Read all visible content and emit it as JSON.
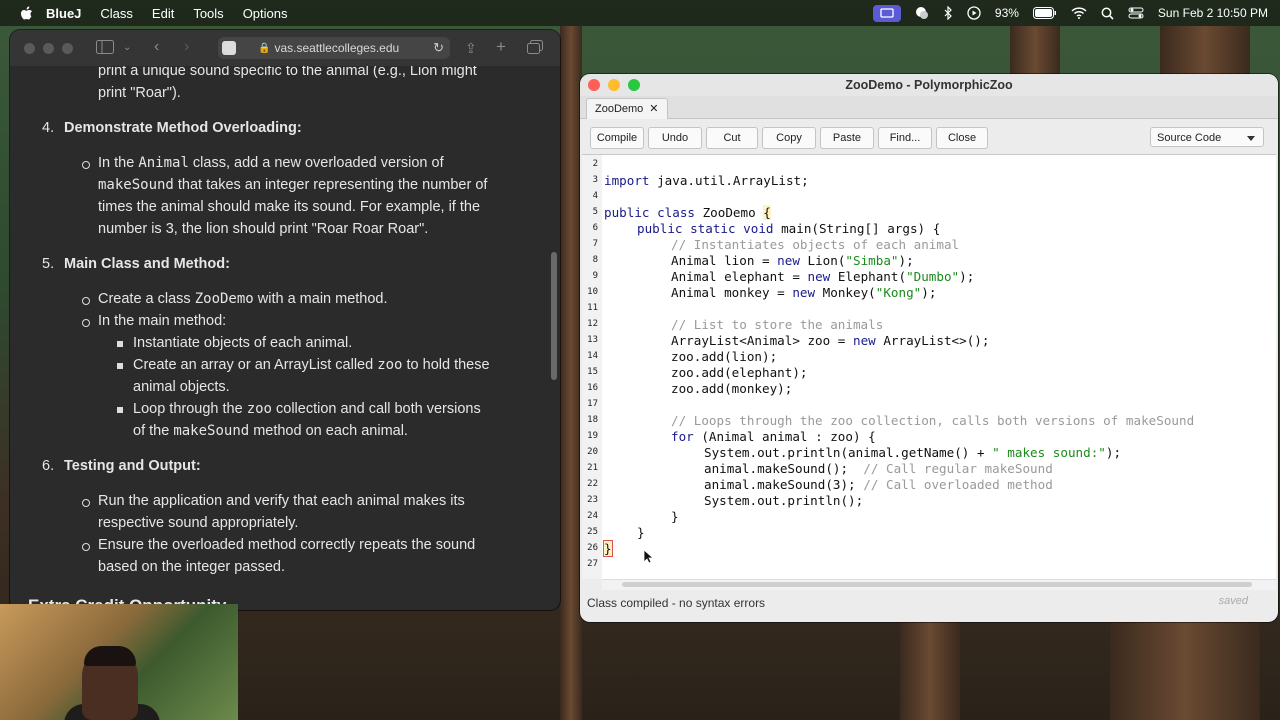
{
  "menubar": {
    "app_name": "BlueJ",
    "items": [
      "Class",
      "Edit",
      "Tools",
      "Options"
    ],
    "battery": "93%",
    "datetime": "Sun Feb 2  10:50 PM"
  },
  "browser": {
    "url": "vas.seattlecolleges.edu",
    "content": {
      "intro_lines": [
        "print a unique sound specific to the animal (e.g., Lion might",
        "print \"Roar\")."
      ],
      "section4": {
        "num": "4.",
        "title": "Demonstrate Method Overloading:",
        "bullet_line1_pre": "In the ",
        "bullet_line1_code": "Animal",
        "bullet_line1_post": " class, add a new overloaded version of",
        "bullet_line2_code": "makeSound",
        "bullet_line2_post": " that takes an integer representing the number of",
        "bullet_line3": "times the animal should make its sound. For example, if the",
        "bullet_line4": "number is 3, the lion should print \"Roar Roar Roar\"."
      },
      "section5": {
        "num": "5.",
        "title": "Main Class and Method:",
        "b1_pre": "Create a class ",
        "b1_code": "ZooDemo",
        "b1_post": " with a main method.",
        "b2": "In the main method:",
        "s1": "Instantiate objects of each animal.",
        "s2_pre": "Create an array or an ArrayList called ",
        "s2_code": "zoo",
        "s2_post": " to hold these",
        "s2_line2": "animal objects.",
        "s3_pre": "Loop through the ",
        "s3_code": "zoo",
        "s3_post": " collection and call both versions",
        "s3_line2_pre": "of the ",
        "s3_line2_code": "makeSound",
        "s3_line2_post": " method on each animal."
      },
      "section6": {
        "num": "6.",
        "title": "Testing and Output:",
        "b1": "Run the application and verify that each animal makes its",
        "b1_line2": "respective sound appropriately.",
        "b2": "Ensure the overloaded method correctly repeats the sound",
        "b2_line2": "based on the integer passed."
      },
      "cut_heading": "Extra Credit Opportunity"
    }
  },
  "bluej": {
    "window_title": "ZooDemo - PolymorphicZoo",
    "tab_label": "ZooDemo",
    "buttons": {
      "compile": "Compile",
      "undo": "Undo",
      "cut": "Cut",
      "copy": "Copy",
      "paste": "Paste",
      "find": "Find...",
      "close": "Close"
    },
    "view_select": "Source Code",
    "line_numbers": [
      "2",
      "3",
      "4",
      "5",
      "6",
      "7",
      "8",
      "9",
      "10",
      "11",
      "12",
      "13",
      "14",
      "15",
      "16",
      "17",
      "18",
      "19",
      "20",
      "21",
      "22",
      "23",
      "24",
      "25",
      "26",
      "27"
    ],
    "code": {
      "l3_kw": "import",
      "l3_rest": " java.util.ArrayList;",
      "l5_kw": "public class",
      "l5_rest": " ZooDemo ",
      "l5_brace": "{",
      "l6_kw": "public static void",
      "l6_rest": " main(String[] args) {",
      "l7": "// Instantiates objects of each animal",
      "l8_a": "Animal lion = ",
      "l8_kw": "new",
      "l8_b": " Lion(",
      "l8_str": "\"Simba\"",
      "l8_c": ");",
      "l9_a": "Animal elephant = ",
      "l9_kw": "new",
      "l9_b": " Elephant(",
      "l9_str": "\"Dumbo\"",
      "l9_c": ");",
      "l10_a": "Animal monkey = ",
      "l10_kw": "new",
      "l10_b": " Monkey(",
      "l10_str": "\"Kong\"",
      "l10_c": ");",
      "l12": "// List to store the animals",
      "l13_a": "ArrayList<Animal> zoo = ",
      "l13_kw": "new",
      "l13_b": " ArrayList<>();",
      "l14": "zoo.add(lion);",
      "l15": "zoo.add(elephant);",
      "l16": "zoo.add(monkey);",
      "l18": "// Loops through the zoo collection, calls both versions of makeSound",
      "l19_kw": "for",
      "l19_rest": " (Animal animal : zoo) {",
      "l20_a": "System.out.println(animal.getName() + ",
      "l20_str": "\" makes sound:\"",
      "l20_b": ");",
      "l21_a": "animal.makeSound();  ",
      "l21_cm": "// Call regular makeSound",
      "l22_a": "animal.makeSound(3); ",
      "l22_cm": "// Call overloaded method",
      "l23": "System.out.println();",
      "l24": "}",
      "l25": "}",
      "l26": "}"
    },
    "status_message": "Class compiled - no syntax errors",
    "saved_label": "saved"
  }
}
